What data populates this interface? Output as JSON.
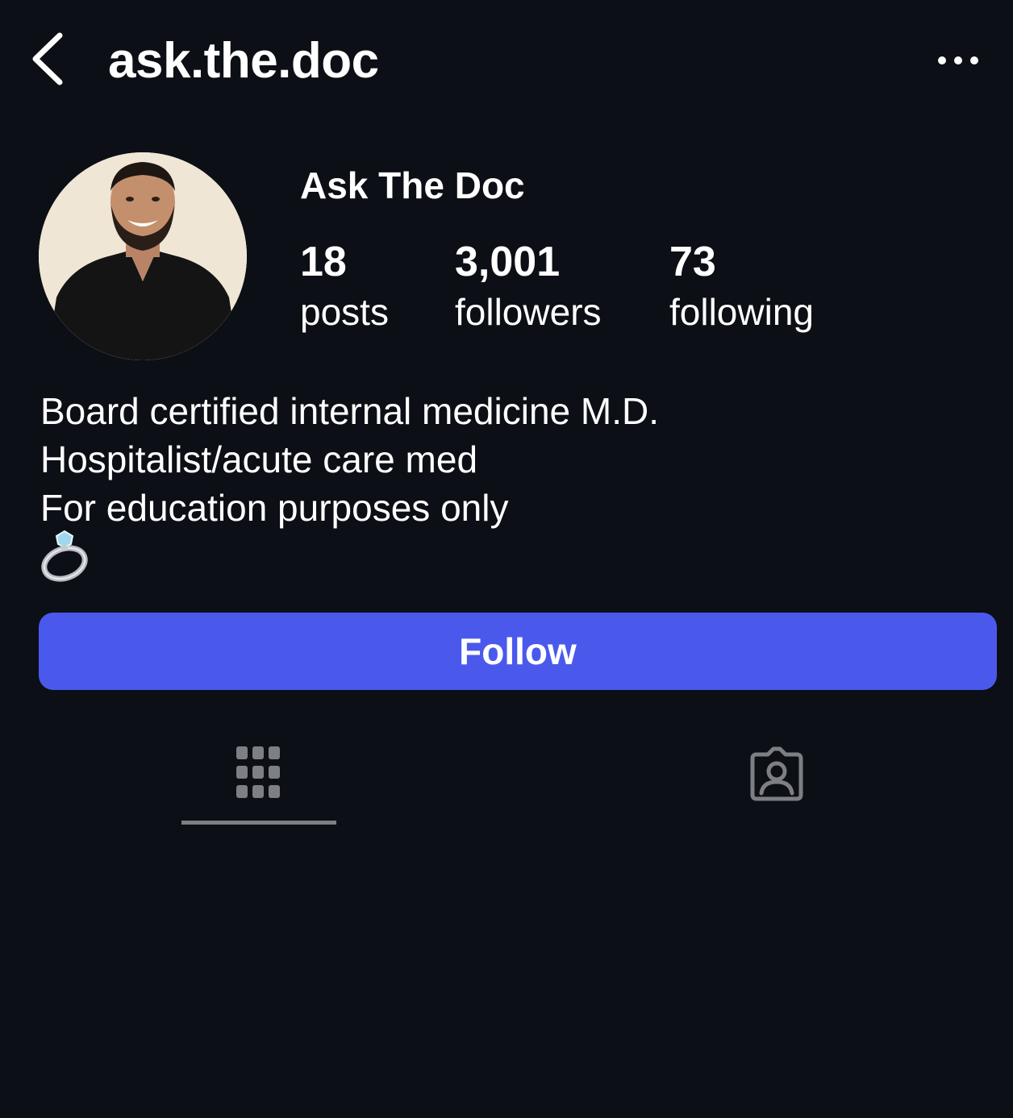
{
  "header": {
    "username": "ask.the.doc",
    "back_icon": "chevron-left-icon",
    "more_icon": "more-horizontal-icon"
  },
  "profile": {
    "display_name": "Ask The Doc",
    "stats": {
      "posts": {
        "value": "18",
        "label": "posts"
      },
      "followers": {
        "value": "3,001",
        "label": "followers"
      },
      "following": {
        "value": "73",
        "label": "following"
      }
    },
    "bio": [
      "Board certified internal medicine M.D.",
      "Hospitalist/acute care med",
      "For education purposes only"
    ],
    "bio_emoji": "ring-icon"
  },
  "actions": {
    "follow_label": "Follow",
    "follow_color": "#4a59ec"
  },
  "tabs": [
    {
      "name": "grid",
      "icon": "grid-icon",
      "active": true
    },
    {
      "name": "tagged",
      "icon": "tagged-person-icon",
      "active": false
    }
  ],
  "colors": {
    "background": "#0c0f15",
    "text": "#ffffff",
    "icon_muted": "#7d7f85"
  }
}
